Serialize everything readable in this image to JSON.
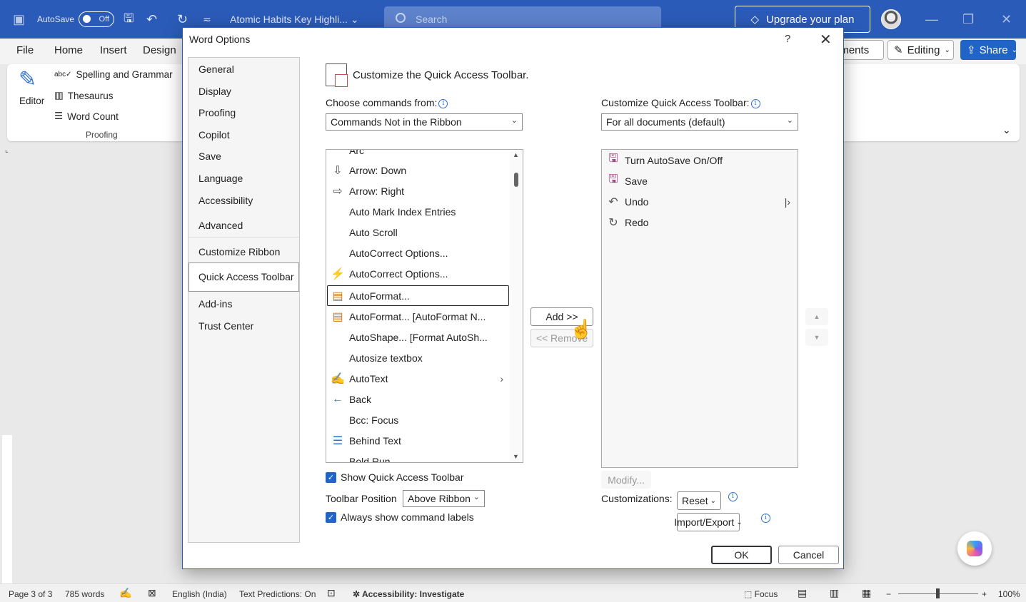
{
  "titlebar": {
    "autosave_label": "AutoSave",
    "autosave_state": "Off",
    "doc_title": "Atomic Habits Key Highli... ⌄",
    "search_placeholder": "Search",
    "upgrade_label": "Upgrade your plan"
  },
  "ribbon": {
    "tabs": [
      "File",
      "Home",
      "Insert",
      "Design"
    ],
    "editor_label": "Editor",
    "spelling_label": "Spelling and Grammar",
    "thesaurus_label": "Thesaurus",
    "wordcount_label": "Word Count",
    "group_label": "Proofing",
    "comments_label": "nments",
    "editing_label": "Editing",
    "share_label": "Share"
  },
  "dialog": {
    "title": "Word Options",
    "help": "?",
    "close": "✕",
    "nav": [
      "General",
      "Display",
      "Proofing",
      "Copilot",
      "Save",
      "Language",
      "Accessibility",
      "Advanced",
      "Customize Ribbon",
      "Quick Access Toolbar",
      "Add-ins",
      "Trust Center"
    ],
    "selected_nav": "Quick Access Toolbar",
    "heading": "Customize the Quick Access Toolbar.",
    "choose_label": "Choose commands from:",
    "choose_value": "Commands Not in the Ribbon",
    "customize_label": "Customize Quick Access Toolbar:",
    "customize_value": "For all documents (default)",
    "commands": [
      {
        "label": "Arc",
        "icon": "arc-icon"
      },
      {
        "label": "Arrow: Down",
        "icon": "arrow-down-icon"
      },
      {
        "label": "Arrow: Right",
        "icon": "arrow-right-icon"
      },
      {
        "label": "Auto Mark Index Entries",
        "icon": ""
      },
      {
        "label": "Auto Scroll",
        "icon": ""
      },
      {
        "label": "AutoCorrect Options...",
        "icon": ""
      },
      {
        "label": "AutoCorrect Options...",
        "icon": "autocorrect-icon"
      },
      {
        "label": "AutoFormat...",
        "icon": "autoformat-icon"
      },
      {
        "label": "AutoFormat... [AutoFormat N...",
        "icon": "autoformat-icon"
      },
      {
        "label": "AutoShape... [Format AutoSh...",
        "icon": ""
      },
      {
        "label": "Autosize textbox",
        "icon": ""
      },
      {
        "label": "AutoText",
        "icon": "autotext-icon"
      },
      {
        "label": "Back",
        "icon": "back-arrow-icon"
      },
      {
        "label": "Bcc: Focus",
        "icon": ""
      },
      {
        "label": "Behind Text",
        "icon": "behind-text-icon"
      },
      {
        "label": "Bold Run",
        "icon": ""
      }
    ],
    "toolbar_items": [
      {
        "label": "Turn AutoSave On/Off",
        "icon": "save-disk-icon"
      },
      {
        "label": "Save",
        "icon": "save-disk-icon"
      },
      {
        "label": "Undo",
        "icon": "undo-icon"
      },
      {
        "label": "Redo",
        "icon": "redo-icon"
      }
    ],
    "add_label": "Add >>",
    "remove_label": "<< Remove",
    "modify_label": "Modify...",
    "show_qat_label": "Show Quick Access Toolbar",
    "toolbar_position_label": "Toolbar Position",
    "toolbar_position_value": "Above Ribbon",
    "always_labels_label": "Always show command labels",
    "customizations_label": "Customizations:",
    "reset_label": "Reset",
    "import_export_label": "Import/Export",
    "ok_label": "OK",
    "cancel_label": "Cancel"
  },
  "statusbar": {
    "page": "Page 3 of 3",
    "words": "785 words",
    "language": "English (India)",
    "predictions": "Text Predictions: On",
    "accessibility": "Accessibility: Investigate",
    "focus": "Focus",
    "zoom": "100%"
  },
  "colors": {
    "titlebar": "#2b5bb9",
    "accent": "#1f64c6"
  }
}
